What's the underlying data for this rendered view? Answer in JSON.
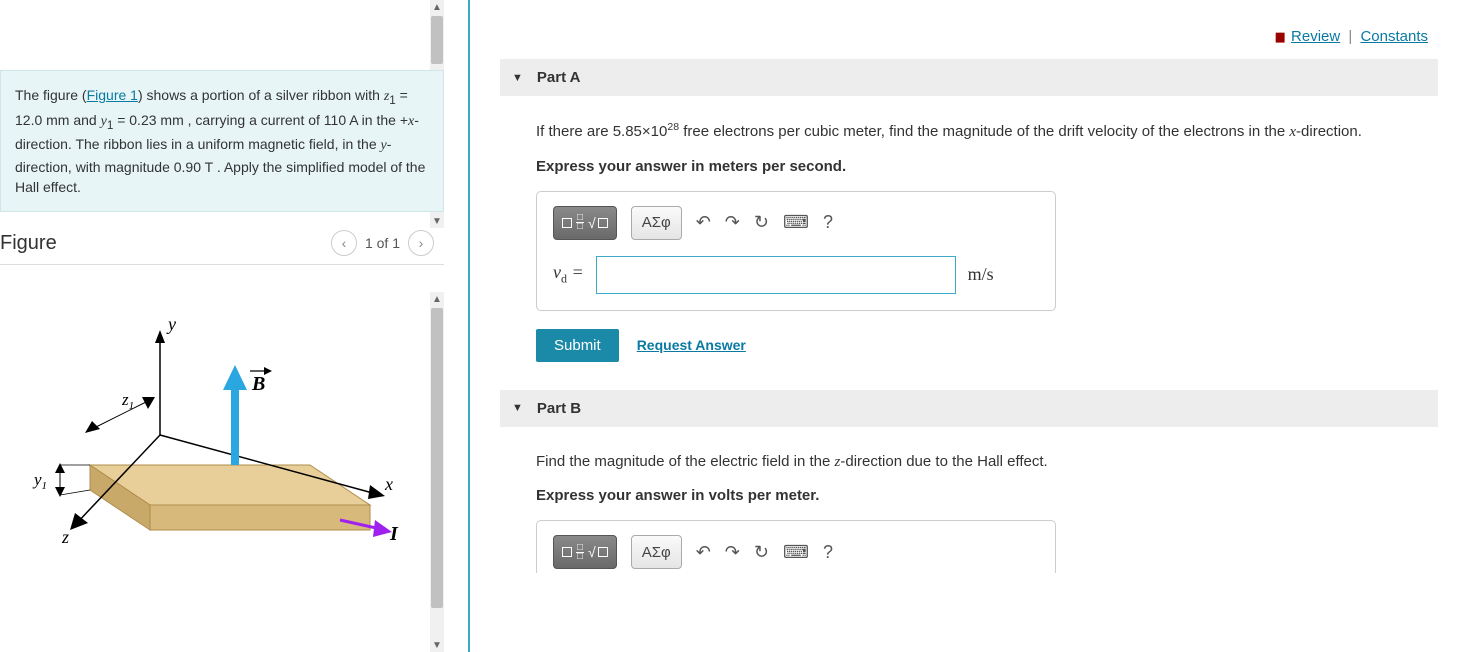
{
  "topLinks": {
    "review": "Review",
    "constants": "Constants"
  },
  "problem": {
    "pre": "The figure (",
    "figLink": "Figure 1",
    "post1": ") shows a portion of a silver ribbon with ",
    "z1_label": "z",
    "z1_sub": "1",
    "z1_eq": " = 12.0 mm",
    "and": " and ",
    "y1_label": "y",
    "y1_sub": "1",
    "y1_eq": " = 0.23 mm",
    "post2": " , carrying a current of 110 A in the +",
    "xdir": "x",
    "post3": "-direction. The ribbon lies in a uniform magnetic field, in the ",
    "ydir": "y",
    "post4": "-direction, with magnitude 0.90 T . Apply the simplified model of the Hall effect."
  },
  "figure": {
    "title": "Figure",
    "pager": "1 of 1",
    "labels": {
      "x": "x",
      "y": "y",
      "z": "z",
      "z1": "z",
      "z1sub": "1",
      "y1": "y",
      "y1sub": "1",
      "B": "B",
      "I": "I"
    }
  },
  "partA": {
    "title": "Part A",
    "question_pre": "If there are 5.85×10",
    "question_sup": "28",
    "question_post": " free electrons per cubic meter, find the magnitude of the drift velocity of the electrons in the ",
    "xvar": "x",
    "question_end": "-direction.",
    "instruction": "Express your answer in meters per second.",
    "var": "v",
    "var_sub": "d",
    "eq": " =",
    "unit": "m/s",
    "submit": "Submit",
    "request": "Request Answer",
    "greek": "ΑΣφ"
  },
  "partB": {
    "title": "Part B",
    "question_pre": "Find the magnitude of the electric field in the ",
    "zvar": "z",
    "question_post": "-direction due to the Hall effect.",
    "instruction": "Express your answer in volts per meter.",
    "greek": "ΑΣφ"
  }
}
